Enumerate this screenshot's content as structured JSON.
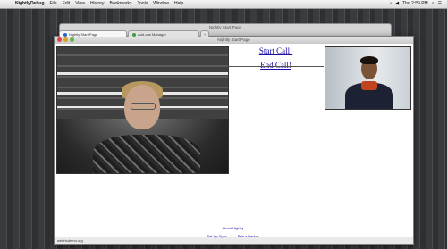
{
  "menubar": {
    "apple_icon": "apple-icon",
    "app_name": "NightlyDebug",
    "items": [
      "File",
      "Edit",
      "View",
      "History",
      "Bookmarks",
      "Tools",
      "Window",
      "Help"
    ],
    "clock": "Thu 2:59 PM"
  },
  "back_window": {
    "title": "Nightly Start Page"
  },
  "window": {
    "title": "Nightly Start Page",
    "tabs": [
      {
        "label": "Nightly Start Page"
      },
      {
        "label": "Add-ons Manager"
      },
      {
        "label": "+"
      }
    ]
  },
  "call": {
    "start_label": "Start Call!",
    "end_label": "End Call!"
  },
  "statusbar": {
    "text": "webrtcdemo.org"
  },
  "footer": {
    "about": "About Nightly",
    "sync": "Set Up Sync",
    "pair": "Pair a Device"
  }
}
